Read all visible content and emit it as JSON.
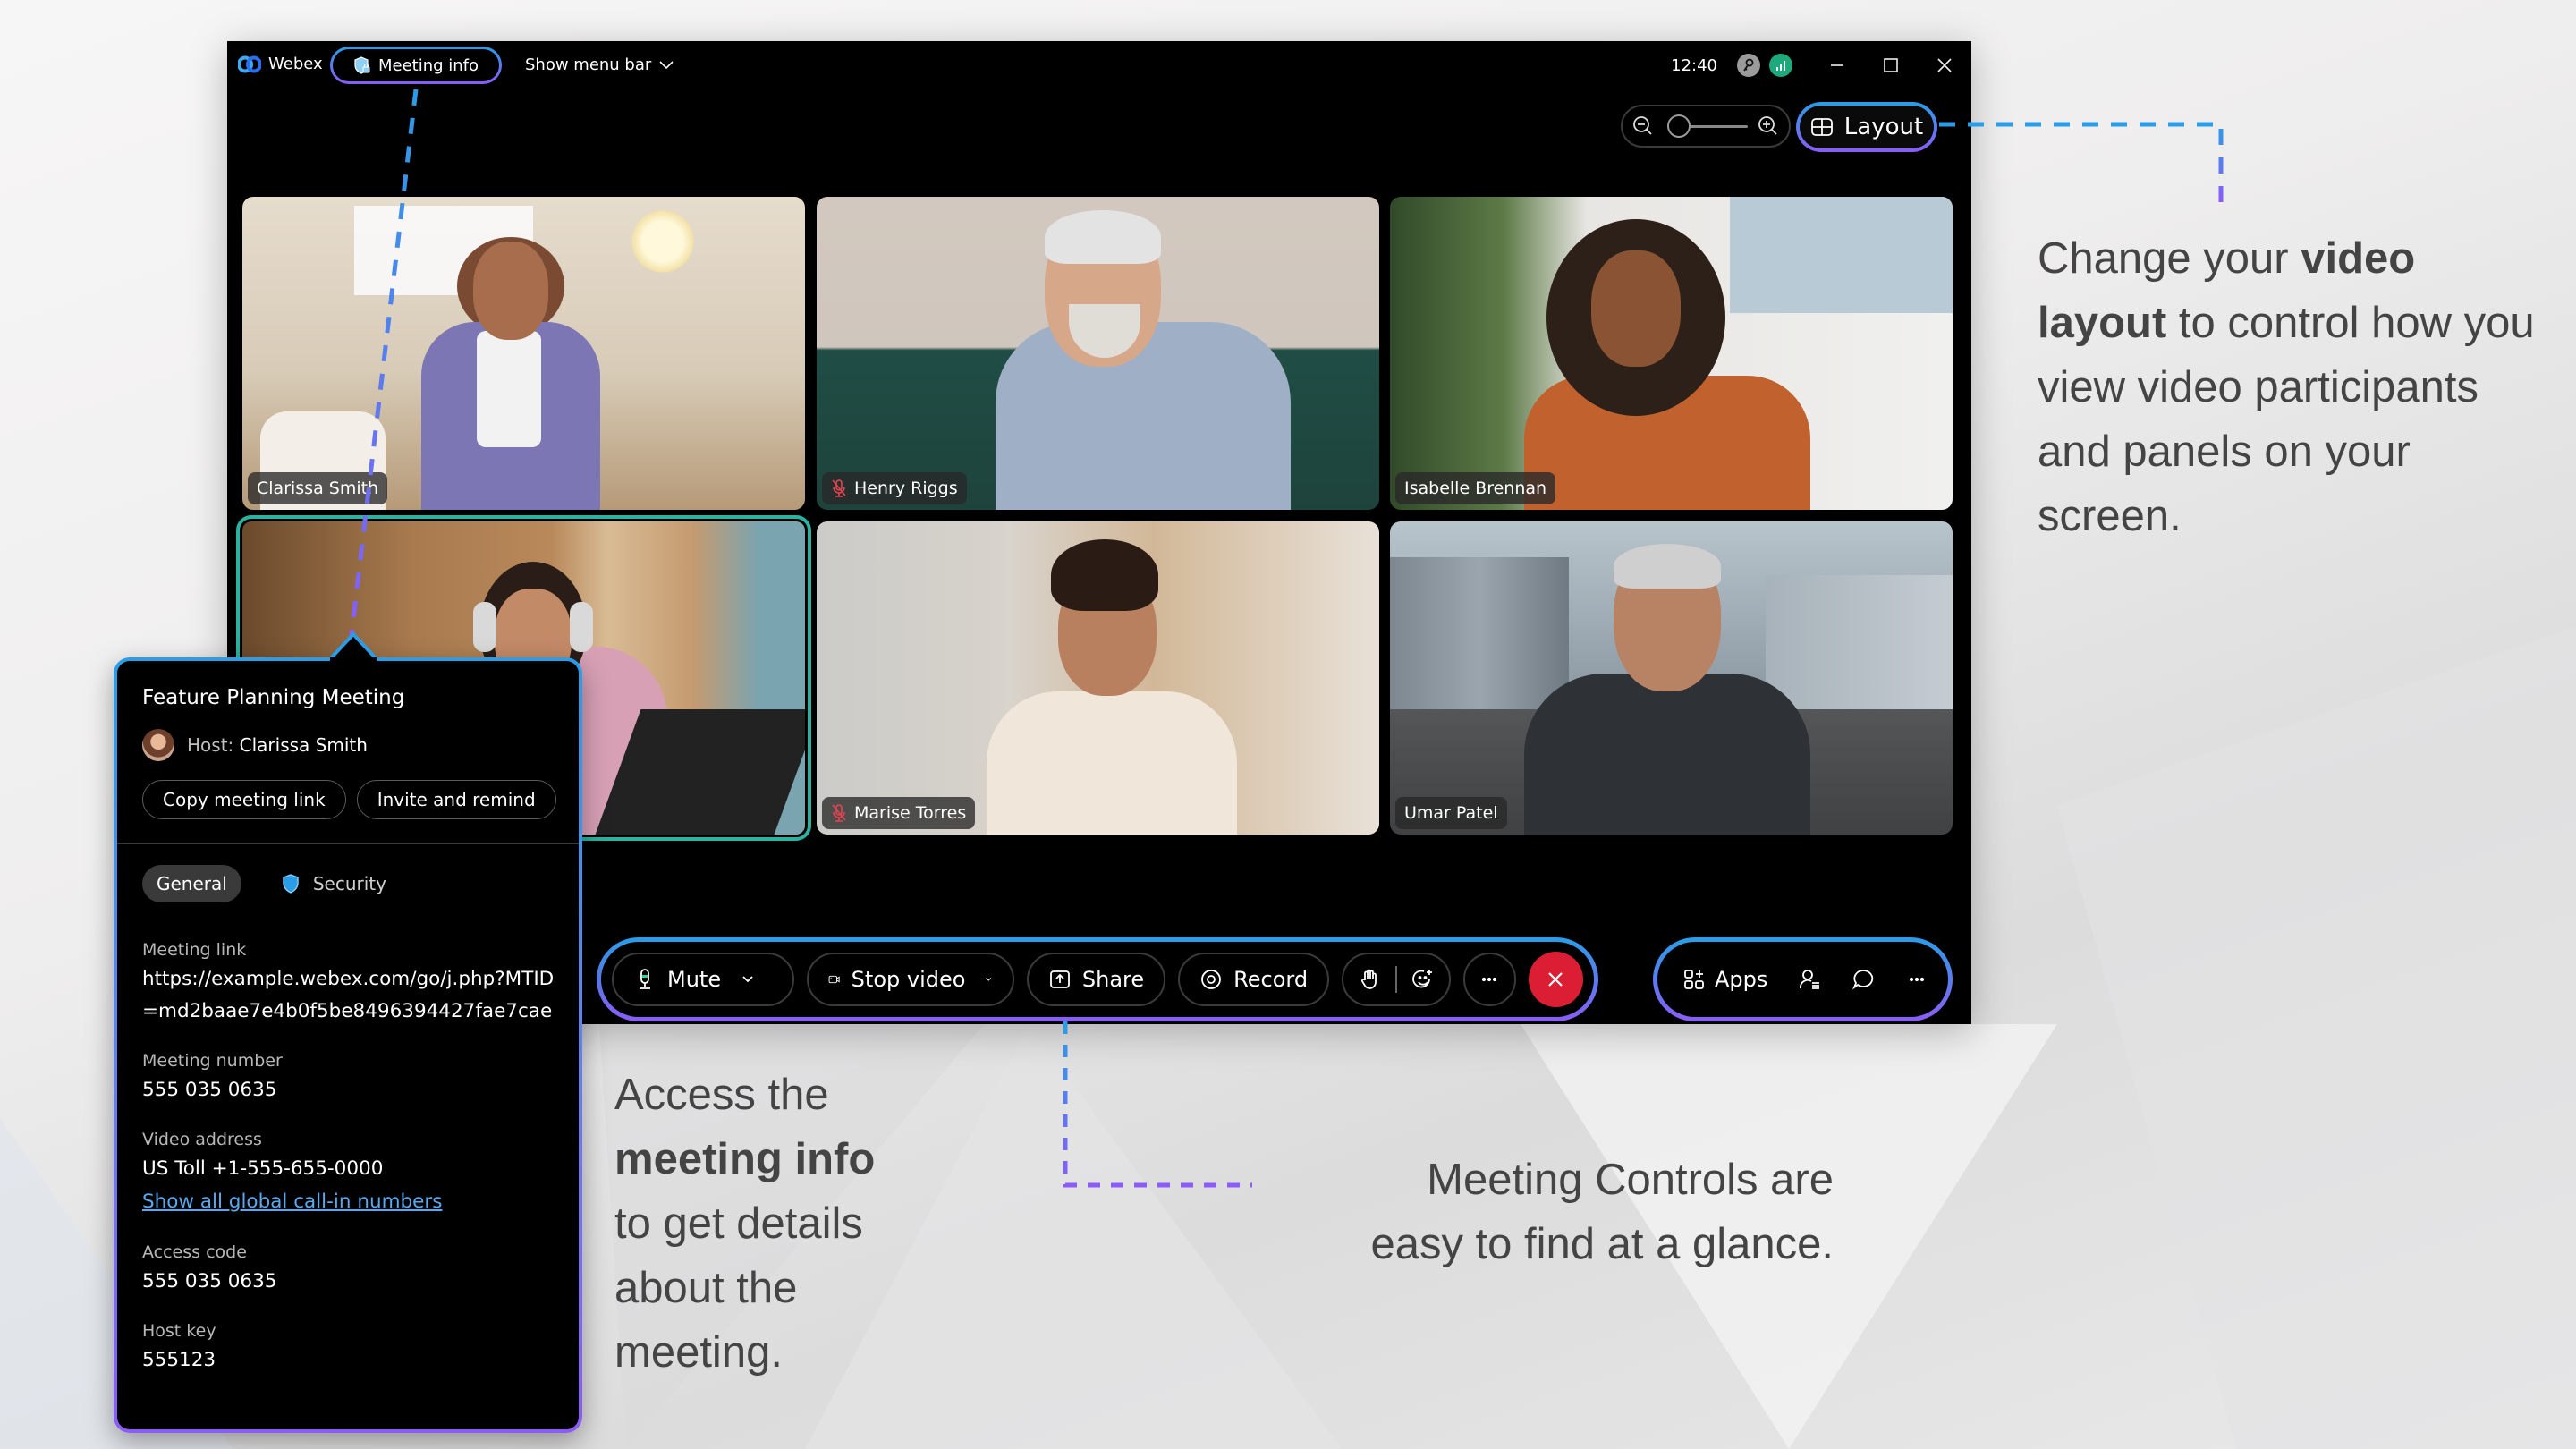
{
  "window": {
    "app_name": "Webex",
    "meeting_info_label": "Meeting info",
    "show_menu_label": "Show menu bar",
    "time": "12:40",
    "zoom_level": 0.1,
    "layout_label": "Layout"
  },
  "participants": [
    {
      "name": "Clarissa Smith",
      "muted": false,
      "active": false
    },
    {
      "name": "Henry Riggs",
      "muted": true,
      "active": false
    },
    {
      "name": "Isabelle Brennan",
      "muted": false,
      "active": false
    },
    {
      "name": "",
      "muted": false,
      "active": true
    },
    {
      "name": "Marise Torres",
      "muted": true,
      "active": false
    },
    {
      "name": "Umar Patel",
      "muted": false,
      "active": false
    }
  ],
  "controls": {
    "mute_label": "Mute",
    "stop_video_label": "Stop video",
    "share_label": "Share",
    "record_label": "Record",
    "apps_label": "Apps",
    "end_color": "#dc1e35"
  },
  "info_panel": {
    "title": "Feature Planning Meeting",
    "host_prefix": "Host:",
    "host_name": "Clarissa Smith",
    "copy_link_label": "Copy meeting link",
    "invite_label": "Invite and remind",
    "tabs": [
      "General",
      "Security"
    ],
    "active_tab": "General",
    "fields": {
      "meeting_link_label": "Meeting link",
      "meeting_link_value": "https://example.webex.com/go/j.php?MTID=md2baae7e4b0f5be8496394427fae7cae",
      "meeting_number_label": "Meeting number",
      "meeting_number_value": "555 035 0635",
      "video_address_label": "Video address",
      "video_address_value": "US Toll +1-555-655-0000",
      "global_numbers_link": "Show all global call-in numbers",
      "access_code_label": "Access code",
      "access_code_value": "555 035 0635",
      "host_key_label": "Host key",
      "host_key_value": "555123"
    }
  },
  "annotations": {
    "layout": {
      "pre": "Change your ",
      "bold": "video layout",
      "post": " to control how you view video participants and panels on your screen."
    },
    "meeting_info": {
      "pre": "Access the ",
      "bold": "meeting info",
      "post": " to get details about the meeting."
    },
    "controls": {
      "line1": "Meeting Controls are",
      "line2": "easy to find at a glance."
    }
  },
  "colors": {
    "accent_blue": "#2a9de6",
    "accent_purple": "#8b5cf6",
    "active_tile": "#2ab3a0",
    "link": "#5aa9ef",
    "muted_icon": "#e8434f"
  }
}
